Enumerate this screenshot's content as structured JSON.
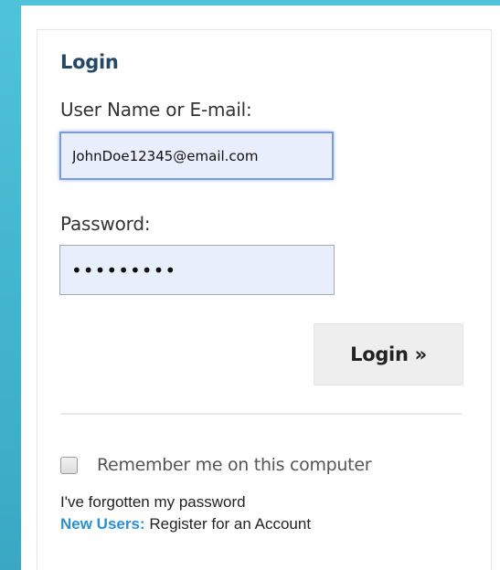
{
  "form": {
    "heading": "Login",
    "username_label": "User Name or E-mail:",
    "username_value": "JohnDoe12345@email.com",
    "password_label": "Password:",
    "password_value": "•••••••••",
    "login_button": "Login »",
    "remember_label": "Remember me on this computer",
    "remember_checked": false,
    "forgot_link": "I've forgotten my password",
    "new_users_label": "New Users:",
    "register_link": " Register for an Account"
  },
  "colors": {
    "background_accent": "#43b6cf",
    "heading": "#244866",
    "new_users": "#2c8fd6",
    "input_fill": "#e8eefc"
  }
}
